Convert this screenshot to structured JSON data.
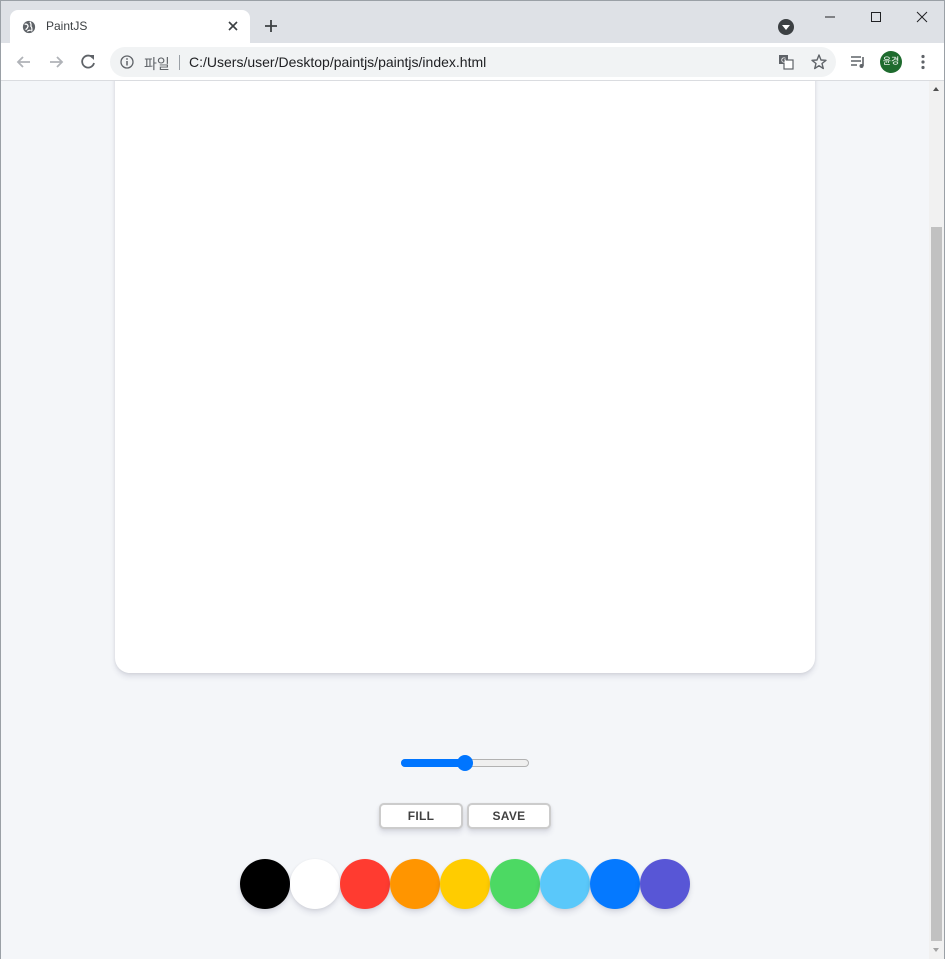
{
  "browser": {
    "tab": {
      "title": "PaintJS",
      "favicon": "globe-icon"
    },
    "omnibox": {
      "scheme_label": "파일",
      "url": "C:/Users/user/Desktop/paintjs/paintjs/index.html"
    },
    "profile_initials": "윤경",
    "icons": [
      "back-icon",
      "forward-icon",
      "reload-icon",
      "info-icon",
      "translate-icon",
      "star-icon",
      "media-icon",
      "menu-icon",
      "minimize-icon",
      "maximize-icon",
      "close-icon",
      "new-tab-icon",
      "tab-search-icon"
    ]
  },
  "app": {
    "canvas_bg": "#ffffff",
    "brush": {
      "value": 0.5,
      "accent": "#0075ff"
    },
    "buttons": {
      "fill": "FILL",
      "save": "SAVE"
    },
    "palette": [
      "#000000",
      "#ffffff",
      "#ff3b30",
      "#ff9500",
      "#ffcc00",
      "#4cd963",
      "#5ac8fa",
      "#0579ff",
      "#5856d6"
    ]
  }
}
